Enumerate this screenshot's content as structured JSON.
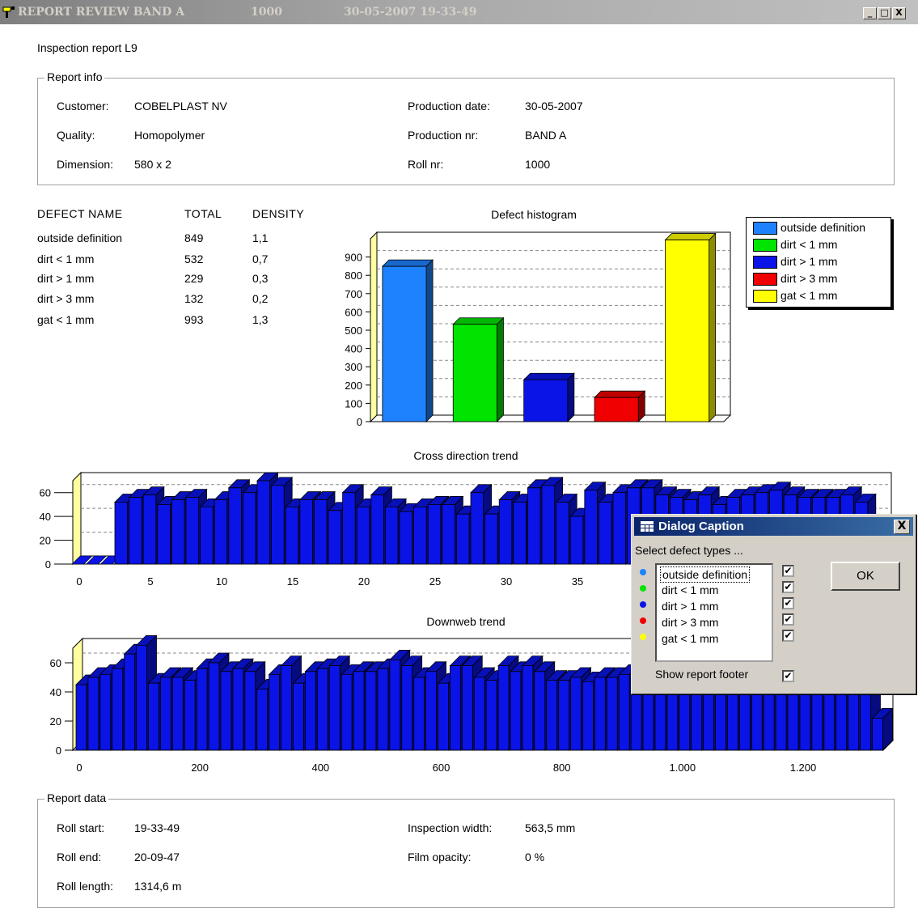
{
  "window": {
    "title_app": "REPORT REVIEW  BAND A",
    "title_roll": "1000",
    "title_datetime": "30-05-2007 19-33-49",
    "minimize": "_",
    "maximize": "□",
    "close": "X"
  },
  "report": {
    "title": "Inspection report L9"
  },
  "report_info": {
    "legend": "Report info",
    "customer_label": "Customer:",
    "customer": "COBELPLAST NV",
    "quality_label": "Quality:",
    "quality": "Homopolymer",
    "dimension_label": "Dimension:",
    "dimension": "580 x 2",
    "production_date_label": "Production date:",
    "production_date": "30-05-2007",
    "production_nr_label": "Production nr:",
    "production_nr": "BAND A",
    "roll_nr_label": "Roll nr:",
    "roll_nr": "1000"
  },
  "defects": {
    "headers": [
      "DEFECT NAME",
      "TOTAL",
      "DENSITY"
    ],
    "rows": [
      {
        "name": "outside definition",
        "total": "849",
        "density": "1,1"
      },
      {
        "name": "dirt < 1 mm",
        "total": "532",
        "density": "0,7"
      },
      {
        "name": "dirt > 1 mm",
        "total": "229",
        "density": "0,3"
      },
      {
        "name": "dirt > 3 mm",
        "total": "132",
        "density": "0,2"
      },
      {
        "name": "gat < 1 mm",
        "total": "993",
        "density": "1,3"
      }
    ]
  },
  "colors": {
    "outside_definition": "#1e82ff",
    "dirt_lt_1": "#00e400",
    "dirt_gt_1": "#0a14e6",
    "dirt_gt_3": "#f00000",
    "gat_lt_1": "#ffff00"
  },
  "chart_data": [
    {
      "type": "bar",
      "title": "Defect histogram",
      "categories": [
        "outside definition",
        "dirt < 1 mm",
        "dirt > 1 mm",
        "dirt > 3 mm",
        "gat < 1 mm"
      ],
      "values": [
        849,
        532,
        229,
        132,
        993
      ],
      "ylim": [
        0,
        1000
      ],
      "yticks": [
        0,
        100,
        200,
        300,
        400,
        500,
        600,
        700,
        800,
        900
      ],
      "grid": true,
      "legend": "right"
    },
    {
      "type": "bar",
      "title": "Cross direction trend",
      "x": [
        0,
        1,
        2,
        3,
        4,
        5,
        6,
        7,
        8,
        9,
        10,
        11,
        12,
        13,
        14,
        15,
        16,
        17,
        18,
        19,
        20,
        21,
        22,
        23,
        24,
        25,
        26,
        27,
        28,
        29,
        30,
        31,
        32,
        33,
        34,
        35,
        36,
        37,
        38,
        39,
        40,
        41,
        42,
        43,
        44,
        45,
        46,
        47,
        48,
        49,
        50,
        51,
        52,
        53,
        54,
        55,
        56
      ],
      "values": [
        0,
        0,
        0,
        52,
        56,
        58,
        50,
        54,
        56,
        48,
        54,
        64,
        60,
        70,
        66,
        48,
        54,
        54,
        45,
        60,
        48,
        58,
        48,
        44,
        48,
        50,
        50,
        42,
        60,
        42,
        54,
        52,
        64,
        66,
        52,
        40,
        62,
        52,
        60,
        64,
        64,
        58,
        56,
        54,
        58,
        50,
        56,
        58,
        60,
        62,
        58,
        56,
        56,
        56,
        58,
        52,
        52
      ],
      "ylim": [
        0,
        70
      ],
      "yticks": [
        0,
        20,
        40,
        60
      ],
      "xticks": [
        0,
        5,
        10,
        15,
        20,
        25,
        30,
        35
      ],
      "grid": true
    },
    {
      "type": "bar",
      "title": "Downweb trend",
      "x_step": 20,
      "values": [
        45,
        50,
        52,
        56,
        66,
        72,
        46,
        50,
        50,
        48,
        56,
        60,
        54,
        56,
        54,
        42,
        52,
        58,
        46,
        54,
        56,
        58,
        52,
        54,
        54,
        56,
        62,
        58,
        50,
        54,
        46,
        58,
        58,
        50,
        48,
        58,
        54,
        58,
        54,
        48,
        48,
        50,
        47,
        50,
        50,
        52,
        50,
        50,
        50,
        50,
        52,
        50,
        50,
        50,
        50,
        50,
        50,
        50,
        50,
        50,
        50,
        50,
        50,
        50,
        50,
        50,
        22
      ],
      "ylim": [
        0,
        70
      ],
      "yticks": [
        0,
        20,
        40,
        60
      ],
      "xticks": [
        0,
        200,
        400,
        600,
        800,
        1000,
        1200
      ],
      "xtick_labels": [
        "0",
        "200",
        "400",
        "600",
        "800",
        "1.000",
        "1.200"
      ],
      "grid": true
    }
  ],
  "report_data": {
    "legend": "Report data",
    "roll_start_label": "Roll start:",
    "roll_start": "19-33-49",
    "roll_end_label": "Roll end:",
    "roll_end": "20-09-47",
    "roll_length_label": "Roll length:",
    "roll_length": "1314,6 m",
    "inspection_width_label": "Inspection width:",
    "inspection_width": "563,5 mm",
    "film_opacity_label": "Film opacity:",
    "film_opacity": "0 %"
  },
  "dialog": {
    "caption": "Dialog Caption",
    "prompt": "Select defect types ...",
    "items": [
      {
        "label": "outside definition",
        "checked": true
      },
      {
        "label": "dirt < 1 mm",
        "checked": true
      },
      {
        "label": "dirt > 1 mm",
        "checked": true
      },
      {
        "label": "dirt > 3 mm",
        "checked": true
      },
      {
        "label": "gat < 1 mm",
        "checked": true
      }
    ],
    "ok": "OK",
    "footer_label": "Show report footer",
    "footer_checked": true,
    "close": "X",
    "check_mark": "✔"
  }
}
